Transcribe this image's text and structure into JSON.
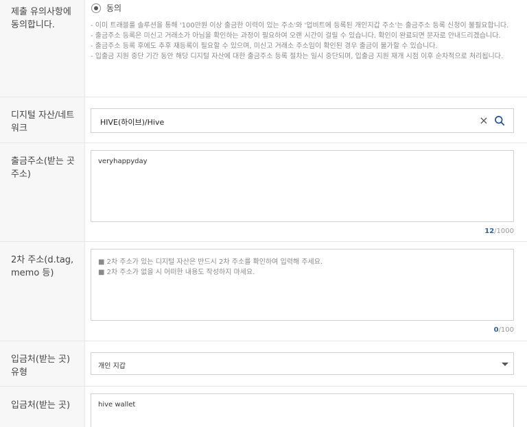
{
  "agreement": {
    "label": "제출 유의사항에 동의합니다.",
    "radio_label": "동의",
    "notices": [
      "- 이미 트래블룰 솔루션을 통해 '100만원 이상 출금한 이력이 있는 주소'와 '업비트에 등록된 개인지갑 주소'는 출금주소 등록 신청이 불필요합니다.",
      "- 출금주소 등록은 미신고 거래소가 아님을 확인하는 과정이 필요하여 오랜 시간이 걸릴 수 있습니다. 확인이 완료되면 문자로 안내드리겠습니다.",
      "- 출금주소 등록 후에도 추후 재등록이 필요할 수 있으며, 미신고 거래소 주소임이 확인된 경우 출금이 불가할 수 있습니다.",
      "- 입출금 지원 중단 기간 동안 해당 디지털 자산에 대한 출금주소 등록 절차는 일시 중단되며, 입출금 지원 재개 시점 이후 순차적으로 처리됩니다."
    ]
  },
  "asset": {
    "label": "디지털 자산/네트워크",
    "value": "HIVE(하이브)/Hive"
  },
  "address": {
    "label": "출금주소(받는 곳 주소)",
    "value": "veryhappyday",
    "count": "12",
    "max": "/1000"
  },
  "secondary": {
    "label": "2차 주소(d.tag, memo 등)",
    "placeholder_line1": "■ 2차 주소가 있는 디지털 자산은 반드시 2차 주소를 확인하여 입력해 주세요.",
    "placeholder_line2": "■ 2차 주소가 없을 시 어떠한 내용도 작성하지 마세요.",
    "count": "0",
    "max": "/100"
  },
  "destination_type": {
    "label": "입금처(받는 곳) 유형",
    "value": "개인 지갑"
  },
  "destination": {
    "label": "입금처(받는 곳)",
    "value": "hive wallet"
  },
  "colors": {
    "counter_accent": "#2b5fa6",
    "search_icon": "#1f4f96"
  }
}
